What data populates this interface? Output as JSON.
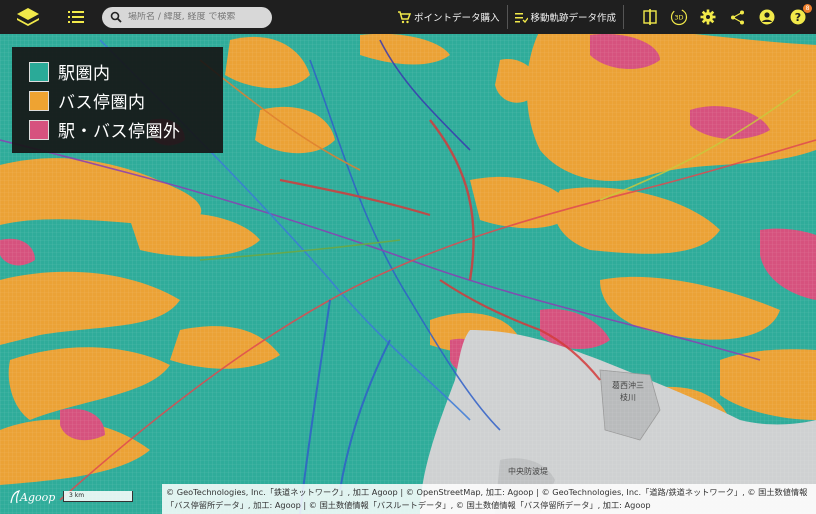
{
  "toolbar": {
    "search_placeholder": "場所名 / 緯度, 経度 で検索",
    "buy_points_label": "ポイントデータ購入",
    "create_trajectory_label": "移動軌跡データ作成",
    "threed_label": "3D",
    "help_badge": "8"
  },
  "legend": {
    "items": [
      {
        "label": "駅圏内",
        "color": "#2aaa98"
      },
      {
        "label": "バス停圏内",
        "color": "#eea332"
      },
      {
        "label": "駅・バス停圏外",
        "color": "#d6527e"
      }
    ]
  },
  "map": {
    "place_labels": [
      "葛西沖三",
      "枝川",
      "中央防波堤"
    ],
    "scale_label": "3 km"
  },
  "brand": "Agoop",
  "attribution": "© GeoTechnologies, Inc.「鉄道ネットワーク」, 加工 Agoop | © OpenStreetMap, 加工: Agoop | © GeoTechnologies, Inc.「道路/鉄道ネットワーク」, © 国土数値情報「バス停留所データ」, 加工: Agoop | © 国土数値情報「バスルートデータ」, © 国土数値情報「バス停留所データ」, 加工: Agoop"
}
